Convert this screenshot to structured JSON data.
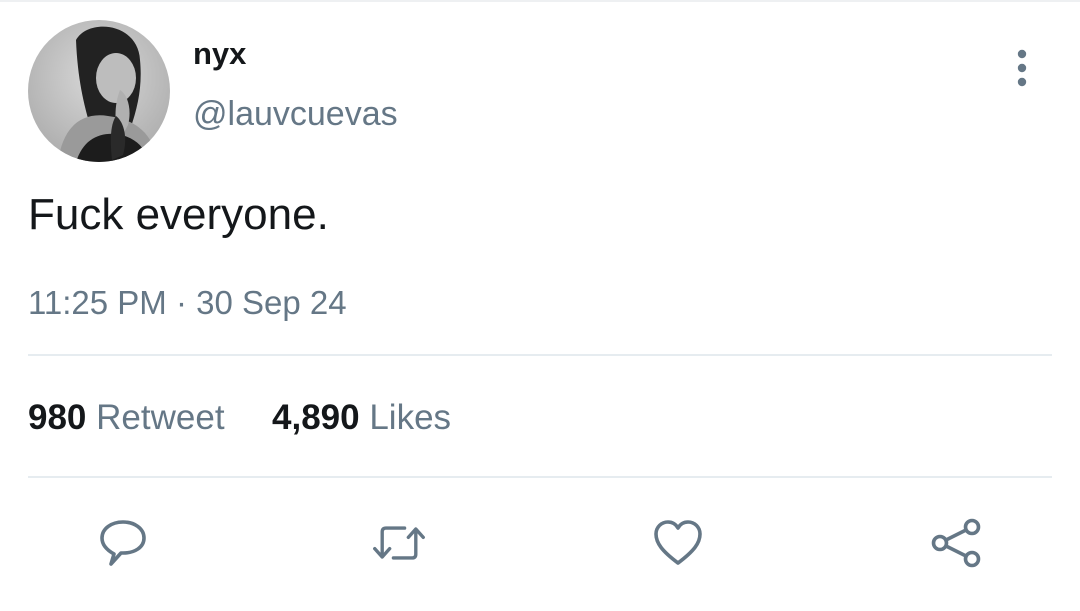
{
  "tweet": {
    "author": {
      "display_name": "nyx",
      "handle": "@lauvcuevas",
      "avatar_icon": "profile-photo"
    },
    "text": "Fuck everyone.",
    "timestamp": "11:25 PM · 30 Sep 24",
    "stats": {
      "retweets_count": "980",
      "retweets_label": "Retweet",
      "likes_count": "4,890",
      "likes_label": "Likes"
    },
    "actions": {
      "reply_icon": "speech-bubble-icon",
      "retweet_icon": "retweet-arrows-icon",
      "like_icon": "heart-icon",
      "share_icon": "share-nodes-icon"
    },
    "more_icon": "vertical-ellipsis-icon"
  },
  "colors": {
    "text_primary": "#14171a",
    "text_secondary": "#657786",
    "divider": "#e6ecf0",
    "background": "#ffffff"
  }
}
